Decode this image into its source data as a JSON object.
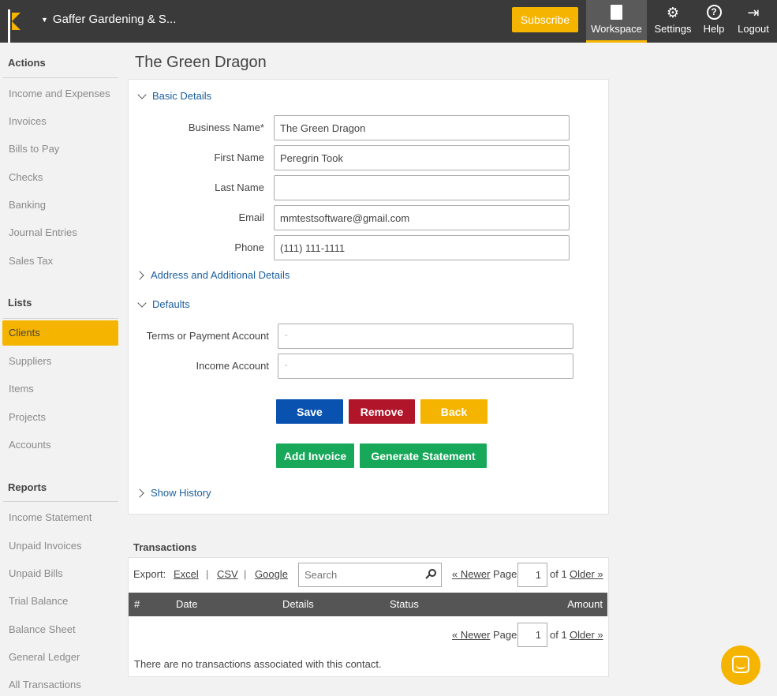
{
  "header": {
    "company": "Gaffer Gardening & S...",
    "subscribe_label": "Subscribe",
    "nav": {
      "workspace": "Workspace",
      "settings": "Settings",
      "help": "Help",
      "logout": "Logout"
    },
    "colors": {
      "bar": "#3a3a3a",
      "accent": "#f5b400"
    }
  },
  "sidebar": {
    "actions_heading": "Actions",
    "actions": [
      "Income and Expenses",
      "Invoices",
      "Bills to Pay",
      "Checks",
      "Banking",
      "Journal Entries",
      "Sales Tax"
    ],
    "lists_heading": "Lists",
    "lists": [
      "Clients",
      "Suppliers",
      "Items",
      "Projects",
      "Accounts"
    ],
    "active_item": "Clients",
    "reports_heading": "Reports",
    "reports": [
      "Income Statement",
      "Unpaid Invoices",
      "Unpaid Bills",
      "Trial Balance",
      "Balance Sheet",
      "General Ledger",
      "All Transactions"
    ]
  },
  "main": {
    "title": "The Green Dragon",
    "basic_details_label": "Basic Details",
    "fields": {
      "business_name": {
        "label": "Business Name*",
        "value": "The Green Dragon"
      },
      "first_name": {
        "label": "First Name",
        "value": "Peregrin Took"
      },
      "last_name": {
        "label": "Last Name",
        "value": ""
      },
      "email": {
        "label": "Email",
        "value": "mmtestsoftware@gmail.com"
      },
      "phone": {
        "label": "Phone",
        "value": "(111) 111-1111"
      }
    },
    "address_label": "Address and Additional Details",
    "defaults_label": "Defaults",
    "defaults": {
      "terms": {
        "label": "Terms or Payment Account",
        "value": "-"
      },
      "income": {
        "label": "Income Account",
        "value": "-"
      }
    },
    "buttons": {
      "save": "Save",
      "remove": "Remove",
      "back": "Back",
      "add_invoice": "Add Invoice",
      "generate_statement": "Generate Statement"
    },
    "button_colors": {
      "save": "#0a52b0",
      "remove": "#b0152a",
      "back": "#f5b400",
      "green": "#17a85a"
    },
    "show_history_label": "Show History"
  },
  "transactions": {
    "title": "Transactions",
    "export_label": "Export:",
    "export_links": [
      "Excel",
      "CSV",
      "Google"
    ],
    "separator": "|",
    "search_placeholder": "Search",
    "pager": {
      "newer": "« Newer",
      "page_word": "Page",
      "page": "1",
      "of": "of 1",
      "older": "Older »"
    },
    "columns": [
      "#",
      "Date",
      "Details",
      "Status",
      "Amount"
    ],
    "empty_message": "There are no transactions associated with this contact."
  }
}
